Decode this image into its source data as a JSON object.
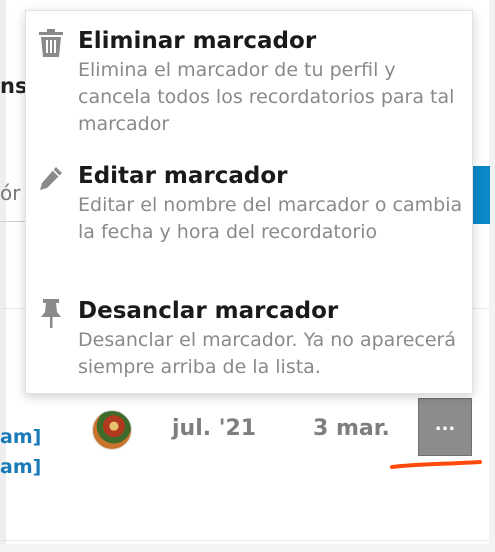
{
  "menu": {
    "items": [
      {
        "icon": "trash-icon",
        "title": "Eliminar marcador",
        "description": "Elimina el marcador de tu perfil y cancela todos los recordatorios para tal marcador"
      },
      {
        "icon": "pencil-icon",
        "title": "Editar marcador",
        "description": "Editar el nombre del marcador o cambia la fecha y hora del recordatorio"
      },
      {
        "icon": "pin-icon",
        "title": "Desanclar marcador",
        "description": "Desanclar el marcador. Ya no aparecerá siempre arriba de la lista."
      }
    ]
  },
  "background": {
    "heading_fragment": "ns",
    "input_fragment": "ór",
    "link_fragments": [
      "am]",
      "am]"
    ],
    "row": {
      "date_created": "jul. '21",
      "date_reminder": "3 mar.",
      "more_label": "..."
    }
  },
  "colors": {
    "link": "#1a7ab8",
    "button_blue": "#0a88c8",
    "more_button": "#8c8c8c",
    "annotation": "#ff4a0a"
  }
}
